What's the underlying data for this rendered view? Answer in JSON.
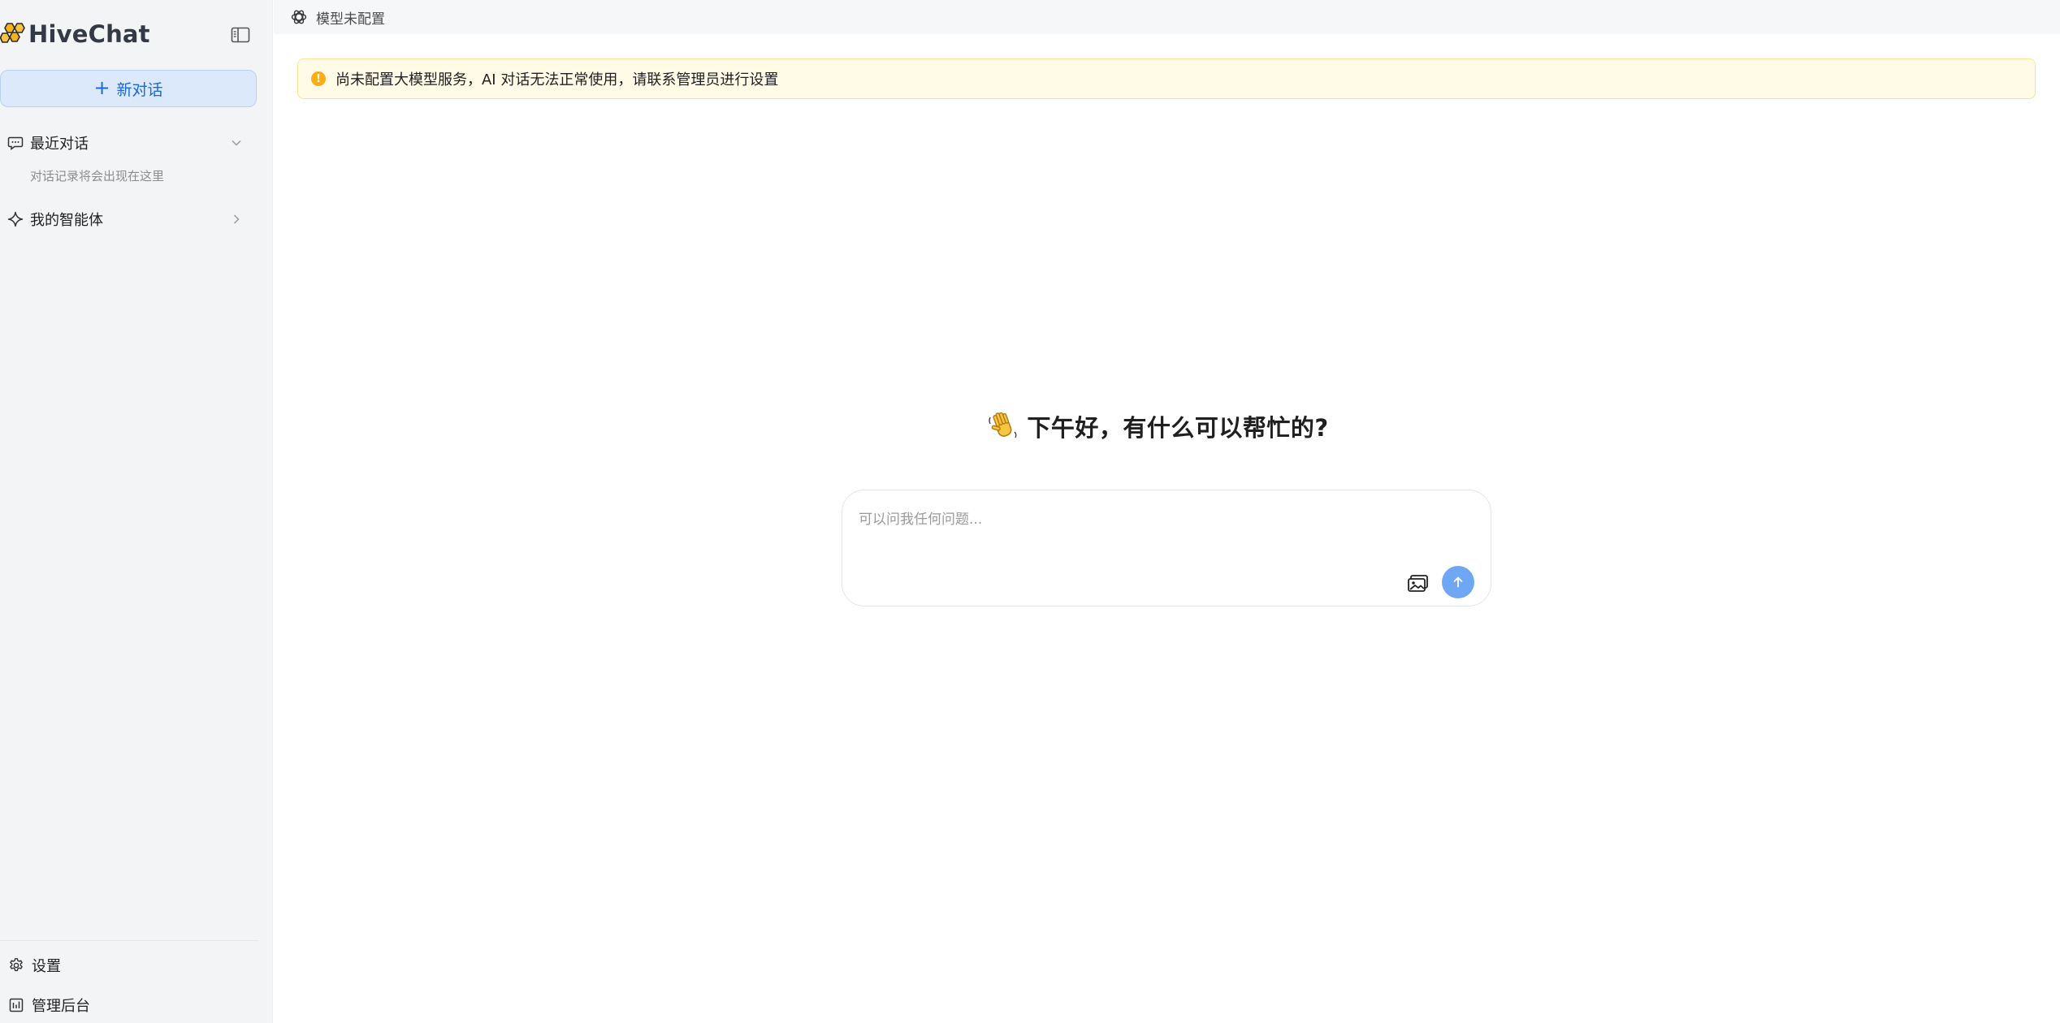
{
  "app": {
    "name": "HiveChat"
  },
  "sidebar": {
    "new_chat_label": "新对话",
    "recent": {
      "label": "最近对话",
      "empty_hint": "对话记录将会出现在这里"
    },
    "agents": {
      "label": "我的智能体"
    },
    "bottom": {
      "settings_label": "设置",
      "admin_label": "管理后台"
    }
  },
  "topbar": {
    "model_label": "模型未配置"
  },
  "alert": {
    "text": "尚未配置大模型服务，AI 对话无法正常使用，请联系管理员进行设置",
    "color": "#faad14"
  },
  "main": {
    "greeting": "下午好，有什么可以帮忙的?",
    "composer": {
      "placeholder": "可以问我任何问题..."
    }
  },
  "colors": {
    "accent": "#1769e0",
    "send_button": "#6fa7f5",
    "sidebar_bg": "#f3f4f6"
  }
}
